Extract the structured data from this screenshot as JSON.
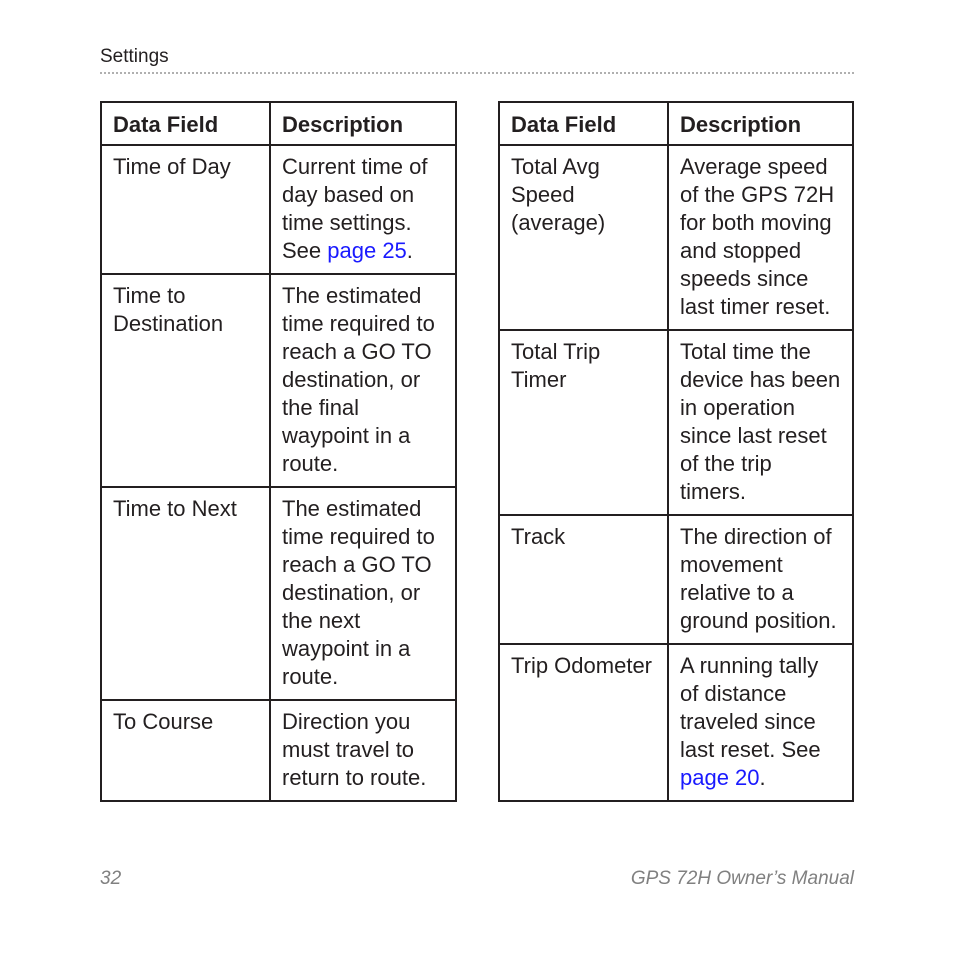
{
  "header": {
    "section": "Settings"
  },
  "tables": [
    {
      "columns": [
        "Data Field",
        "Description"
      ],
      "rows": [
        {
          "field": "Time of Day",
          "desc": "Current time of day based on time settings. See ",
          "link": "page 25",
          "after": "."
        },
        {
          "field": "Time to Destination",
          "desc": "The estimated time required to reach a GO TO destination, or the final waypoint in a route.",
          "link": null,
          "after": null
        },
        {
          "field": "Time to Next",
          "desc": "The estimated time required to reach a GO TO destination, or the next waypoint in a route.",
          "link": null,
          "after": null
        },
        {
          "field": "To Course",
          "desc": "Direction you must travel to return to route.",
          "link": null,
          "after": null
        }
      ]
    },
    {
      "columns": [
        "Data Field",
        "Description"
      ],
      "rows": [
        {
          "field": "Total Avg Speed (average)",
          "desc": "Average speed of the GPS 72H for both moving and stopped speeds since last timer reset.",
          "link": null,
          "after": null
        },
        {
          "field": "Total Trip Timer",
          "desc": "Total time the device has been in operation since last reset of the trip timers.",
          "link": null,
          "after": null
        },
        {
          "field": "Track",
          "desc": "The direction of movement relative to a ground position.",
          "link": null,
          "after": null
        },
        {
          "field": "Trip Odometer",
          "desc": "A running tally of distance traveled since last reset. See ",
          "link": "page 20",
          "after": "."
        }
      ]
    }
  ],
  "colors": {
    "link": "#1a1aff",
    "text": "#231f20",
    "footer": "#808080"
  },
  "footer": {
    "page_number": "32",
    "manual_title": "GPS 72H Owner’s Manual"
  }
}
